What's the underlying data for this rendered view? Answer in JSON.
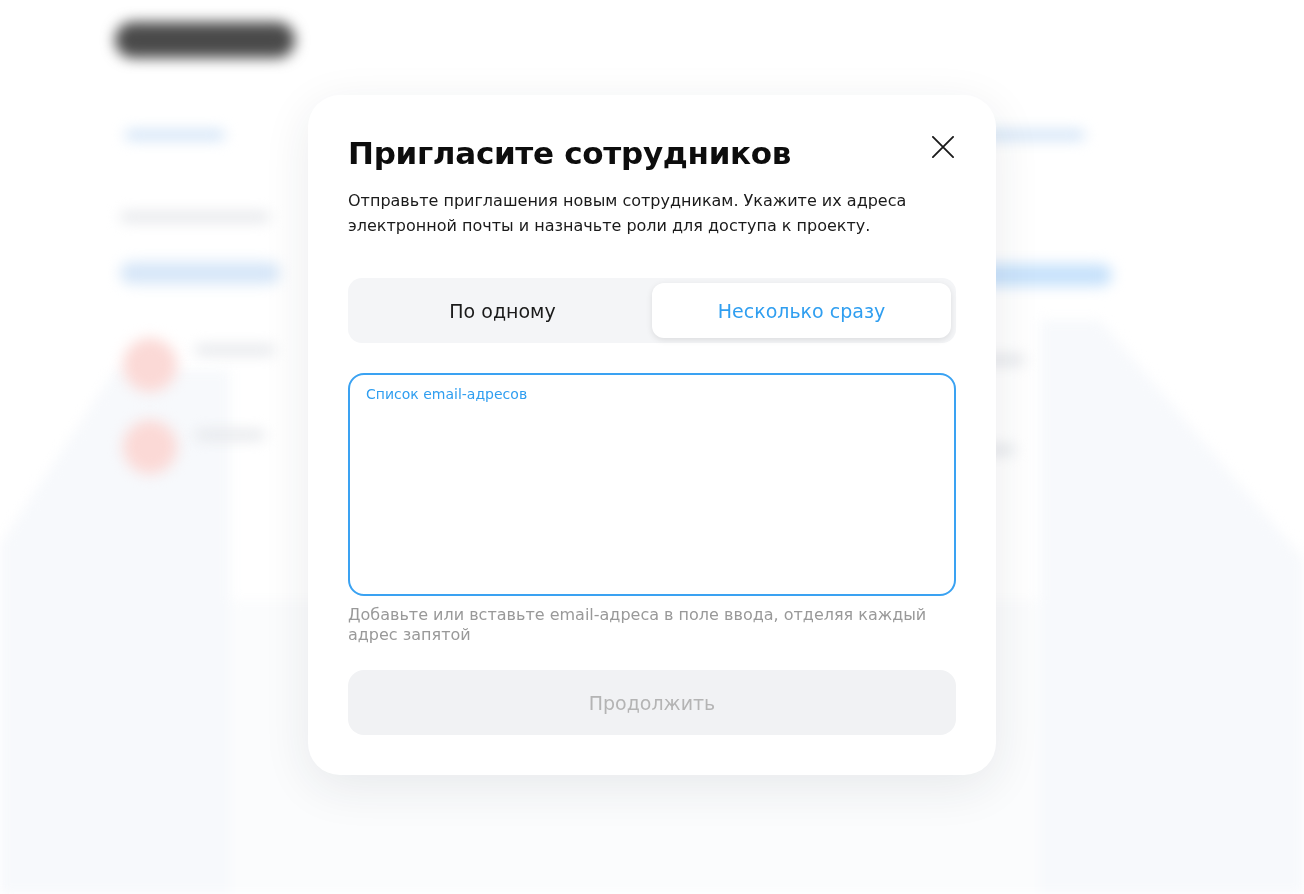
{
  "dialog": {
    "title": "Пригласите сотрудников",
    "description": "Отправьте приглашения новым сотрудникам. Укажите их адреса электронной почты и назначьте роли для доступа к проекту.",
    "tabs": [
      {
        "label": "По одному",
        "selected": false
      },
      {
        "label": "Несколько сразу",
        "selected": true
      }
    ],
    "emails_field": {
      "label": "Список email-адресов",
      "focused": true
    },
    "hint": "Добавьте или вставьте email-адреса в поле ввода, отделяя каждый адрес запятой",
    "continue_button": {
      "label": "Продолжить",
      "disabled": true
    }
  }
}
